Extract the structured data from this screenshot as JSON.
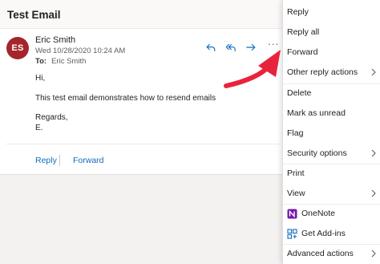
{
  "header": {
    "subject": "Test Email"
  },
  "message": {
    "avatar_initials": "ES",
    "sender": "Eric Smith",
    "date": "Wed 10/28/2020 10:24 AM",
    "to_label": "To:",
    "to_name": "Eric Smith",
    "body": {
      "greeting": "Hi,",
      "text": "This test email demonstrates how to resend emails",
      "closing": "Regards,",
      "signature": "E."
    },
    "footer": {
      "reply": "Reply",
      "forward": "Forward"
    }
  },
  "menu": {
    "items": [
      "Reply",
      "Reply all",
      "Forward",
      "Other reply actions",
      "Delete",
      "Mark as unread",
      "Flag",
      "Security options",
      "Print",
      "View",
      "OneNote",
      "Get Add-ins",
      "Advanced actions"
    ]
  },
  "colors": {
    "accent": "#0f6cbd",
    "avatar": "#a4262c",
    "annotation_arrow": "#e8243c",
    "onenote": "#7719aa"
  }
}
